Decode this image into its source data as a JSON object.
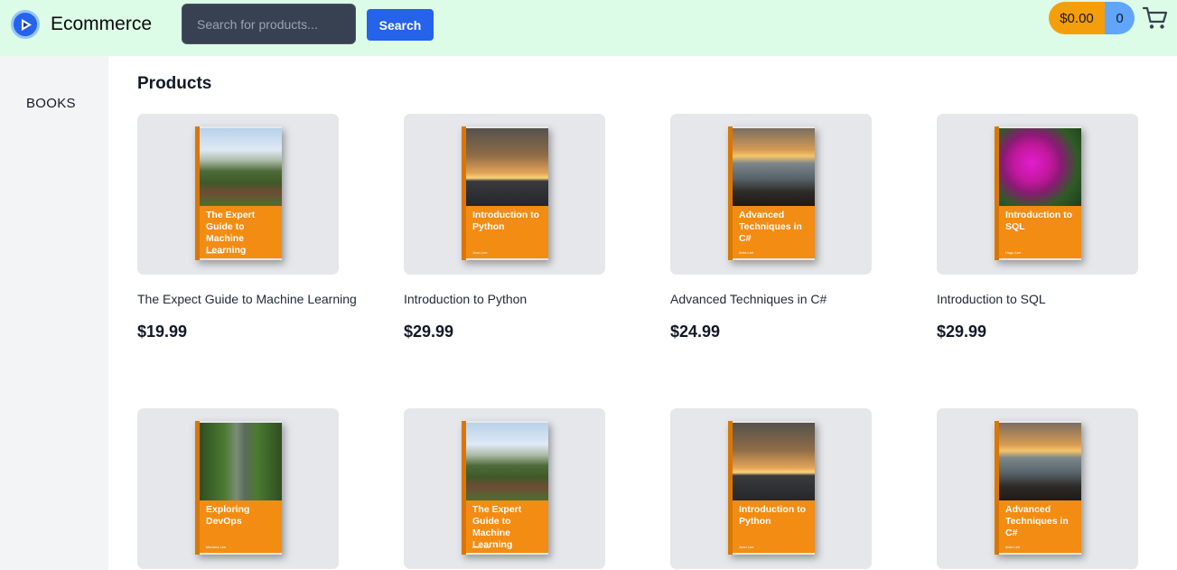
{
  "header": {
    "brand": "Ecommerce",
    "search_placeholder": "Search for products...",
    "search_button": "Search",
    "cart_total": "$0.00",
    "cart_count": "0"
  },
  "sidebar": {
    "items": [
      {
        "label": "BOOKS"
      }
    ]
  },
  "main": {
    "title": "Products",
    "products": [
      {
        "cover_title": "The Expert Guide to Machine Learning",
        "cover_author": "Ahmet Lee",
        "cover_photo": "forest-landscape",
        "name": "The Expect Guide to Machine Learning",
        "price": "$19.99"
      },
      {
        "cover_title": "Introduction to Python",
        "cover_author": "Juan Lee",
        "cover_photo": "ocean-sunset",
        "name": "Introduction to Python",
        "price": "$29.99"
      },
      {
        "cover_title": "Advanced Techniques in C#",
        "cover_author": "Arda Lee",
        "cover_photo": "rocky-shore-sunset",
        "name": "Advanced Techniques in C#",
        "price": "$24.99"
      },
      {
        "cover_title": "Introduction to SQL",
        "cover_author": "Hugo Lee",
        "cover_photo": "pink-flowers",
        "name": "Introduction to SQL",
        "price": "$29.99"
      },
      {
        "cover_title": "Exploring DevOps",
        "cover_author": "Mariana Lee",
        "cover_photo": "jungle-path"
      },
      {
        "cover_title": "The Expert Guide to Machine Learning",
        "cover_author": "Ahmet Lee",
        "cover_photo": "forest-landscape"
      },
      {
        "cover_title": "Introduction to Python",
        "cover_author": "Juan Lee",
        "cover_photo": "ocean-sunset"
      },
      {
        "cover_title": "Advanced Techniques in C#",
        "cover_author": "Arda Lee",
        "cover_photo": "rocky-shore-sunset"
      }
    ]
  },
  "colors": {
    "header_bg": "#dcfce7",
    "search_button_bg": "#2563eb",
    "cart_total_bg": "#f59e0b",
    "cart_count_bg": "#60a5fa",
    "cover_orange": "#f28c13"
  },
  "icons": [
    "play-circle-logo-icon",
    "shopping-cart-icon"
  ]
}
